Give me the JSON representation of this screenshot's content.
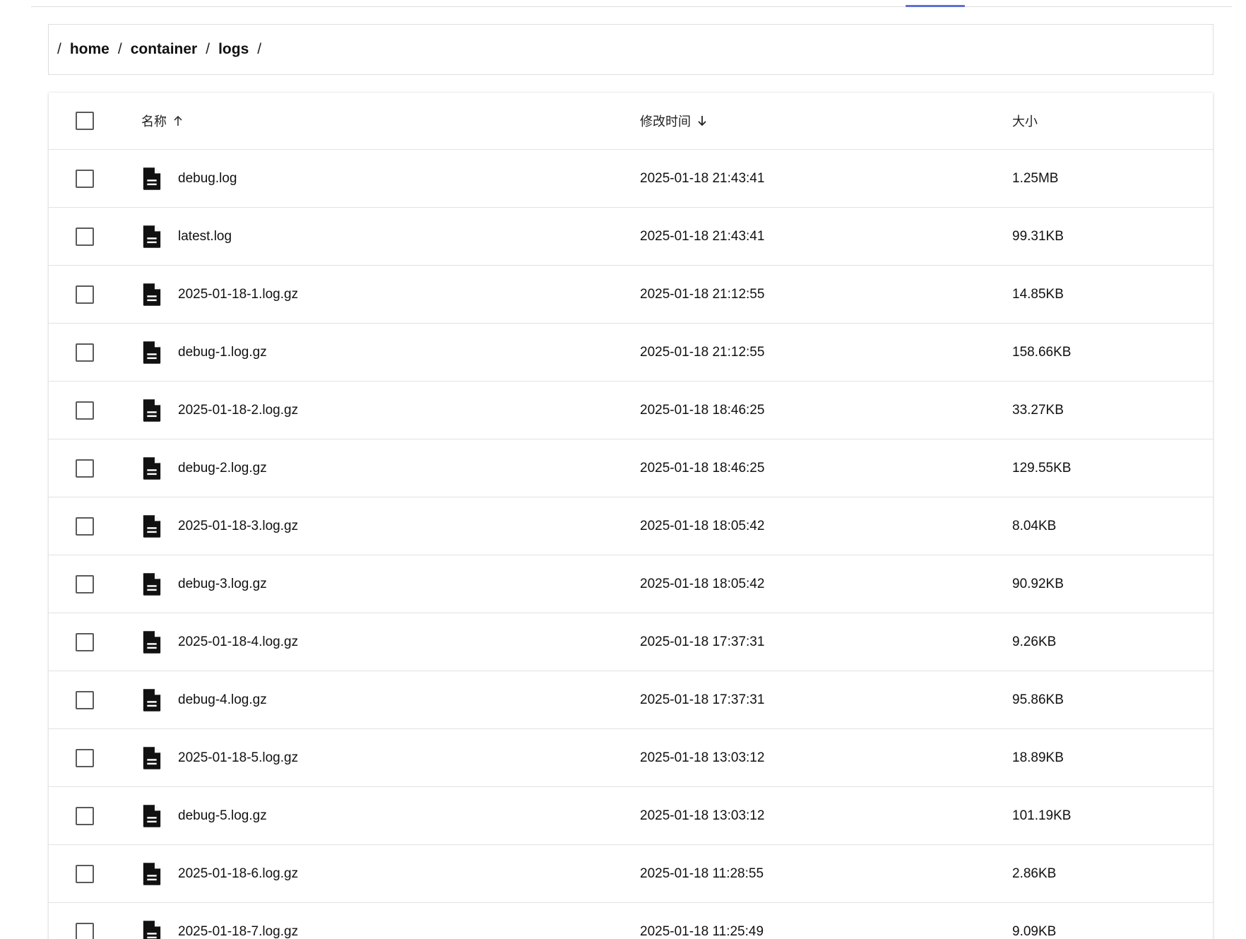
{
  "breadcrumb": {
    "separator": "/",
    "items": [
      "home",
      "container",
      "logs"
    ]
  },
  "table": {
    "columns": {
      "name": "名称",
      "modified": "修改时间",
      "size": "大小"
    },
    "rows": [
      {
        "name": "debug.log",
        "modified": "2025-01-18 21:43:41",
        "size": "1.25MB"
      },
      {
        "name": "latest.log",
        "modified": "2025-01-18 21:43:41",
        "size": "99.31KB"
      },
      {
        "name": "2025-01-18-1.log.gz",
        "modified": "2025-01-18 21:12:55",
        "size": "14.85KB"
      },
      {
        "name": "debug-1.log.gz",
        "modified": "2025-01-18 21:12:55",
        "size": "158.66KB"
      },
      {
        "name": "2025-01-18-2.log.gz",
        "modified": "2025-01-18 18:46:25",
        "size": "33.27KB"
      },
      {
        "name": "debug-2.log.gz",
        "modified": "2025-01-18 18:46:25",
        "size": "129.55KB"
      },
      {
        "name": "2025-01-18-3.log.gz",
        "modified": "2025-01-18 18:05:42",
        "size": "8.04KB"
      },
      {
        "name": "debug-3.log.gz",
        "modified": "2025-01-18 18:05:42",
        "size": "90.92KB"
      },
      {
        "name": "2025-01-18-4.log.gz",
        "modified": "2025-01-18 17:37:31",
        "size": "9.26KB"
      },
      {
        "name": "debug-4.log.gz",
        "modified": "2025-01-18 17:37:31",
        "size": "95.86KB"
      },
      {
        "name": "2025-01-18-5.log.gz",
        "modified": "2025-01-18 13:03:12",
        "size": "18.89KB"
      },
      {
        "name": "debug-5.log.gz",
        "modified": "2025-01-18 13:03:12",
        "size": "101.19KB"
      },
      {
        "name": "2025-01-18-6.log.gz",
        "modified": "2025-01-18 11:28:55",
        "size": "2.86KB"
      },
      {
        "name": "2025-01-18-7.log.gz",
        "modified": "2025-01-18 11:25:49",
        "size": "9.09KB"
      }
    ]
  },
  "icons": {
    "file": "file-text-icon",
    "sort_asc": "arrow-up-icon",
    "sort_desc": "arrow-down-icon"
  },
  "colors": {
    "accent": "#5b6fd6",
    "border": "#e2e2e2",
    "checkbox": "#5a5a5a"
  }
}
